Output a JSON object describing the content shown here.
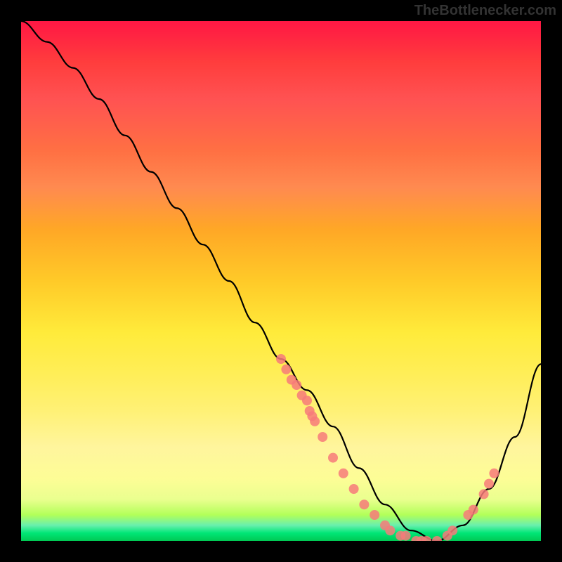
{
  "watermark": "TheBottlenecker.com",
  "chart_data": {
    "type": "line",
    "title": "",
    "xlabel": "",
    "ylabel": "",
    "xlim": [
      0,
      100
    ],
    "ylim": [
      0,
      100
    ],
    "curve": {
      "x": [
        0,
        5,
        10,
        15,
        20,
        25,
        30,
        35,
        40,
        45,
        50,
        55,
        60,
        65,
        70,
        75,
        80,
        85,
        90,
        95,
        100
      ],
      "y": [
        100,
        96,
        91,
        85,
        78,
        71,
        64,
        57,
        50,
        42,
        35,
        29,
        22,
        14,
        7,
        2,
        0,
        3,
        10,
        20,
        34
      ]
    },
    "scatter_points": [
      {
        "x": 50,
        "y": 35
      },
      {
        "x": 51,
        "y": 33
      },
      {
        "x": 52,
        "y": 31
      },
      {
        "x": 53,
        "y": 30
      },
      {
        "x": 54,
        "y": 28
      },
      {
        "x": 55,
        "y": 27
      },
      {
        "x": 55.5,
        "y": 25
      },
      {
        "x": 56,
        "y": 24
      },
      {
        "x": 56.5,
        "y": 23
      },
      {
        "x": 58,
        "y": 20
      },
      {
        "x": 60,
        "y": 16
      },
      {
        "x": 62,
        "y": 13
      },
      {
        "x": 64,
        "y": 10
      },
      {
        "x": 66,
        "y": 7
      },
      {
        "x": 68,
        "y": 5
      },
      {
        "x": 70,
        "y": 3
      },
      {
        "x": 71,
        "y": 2
      },
      {
        "x": 73,
        "y": 1
      },
      {
        "x": 74,
        "y": 1
      },
      {
        "x": 76,
        "y": 0
      },
      {
        "x": 77,
        "y": 0
      },
      {
        "x": 78,
        "y": 0
      },
      {
        "x": 80,
        "y": 0
      },
      {
        "x": 82,
        "y": 1
      },
      {
        "x": 83,
        "y": 2
      },
      {
        "x": 86,
        "y": 5
      },
      {
        "x": 87,
        "y": 6
      },
      {
        "x": 89,
        "y": 9
      },
      {
        "x": 90,
        "y": 11
      },
      {
        "x": 91,
        "y": 13
      }
    ],
    "gradient_colors": {
      "top": "#ff1744",
      "mid": "#ffeb3b",
      "bottom": "#00c853"
    }
  }
}
